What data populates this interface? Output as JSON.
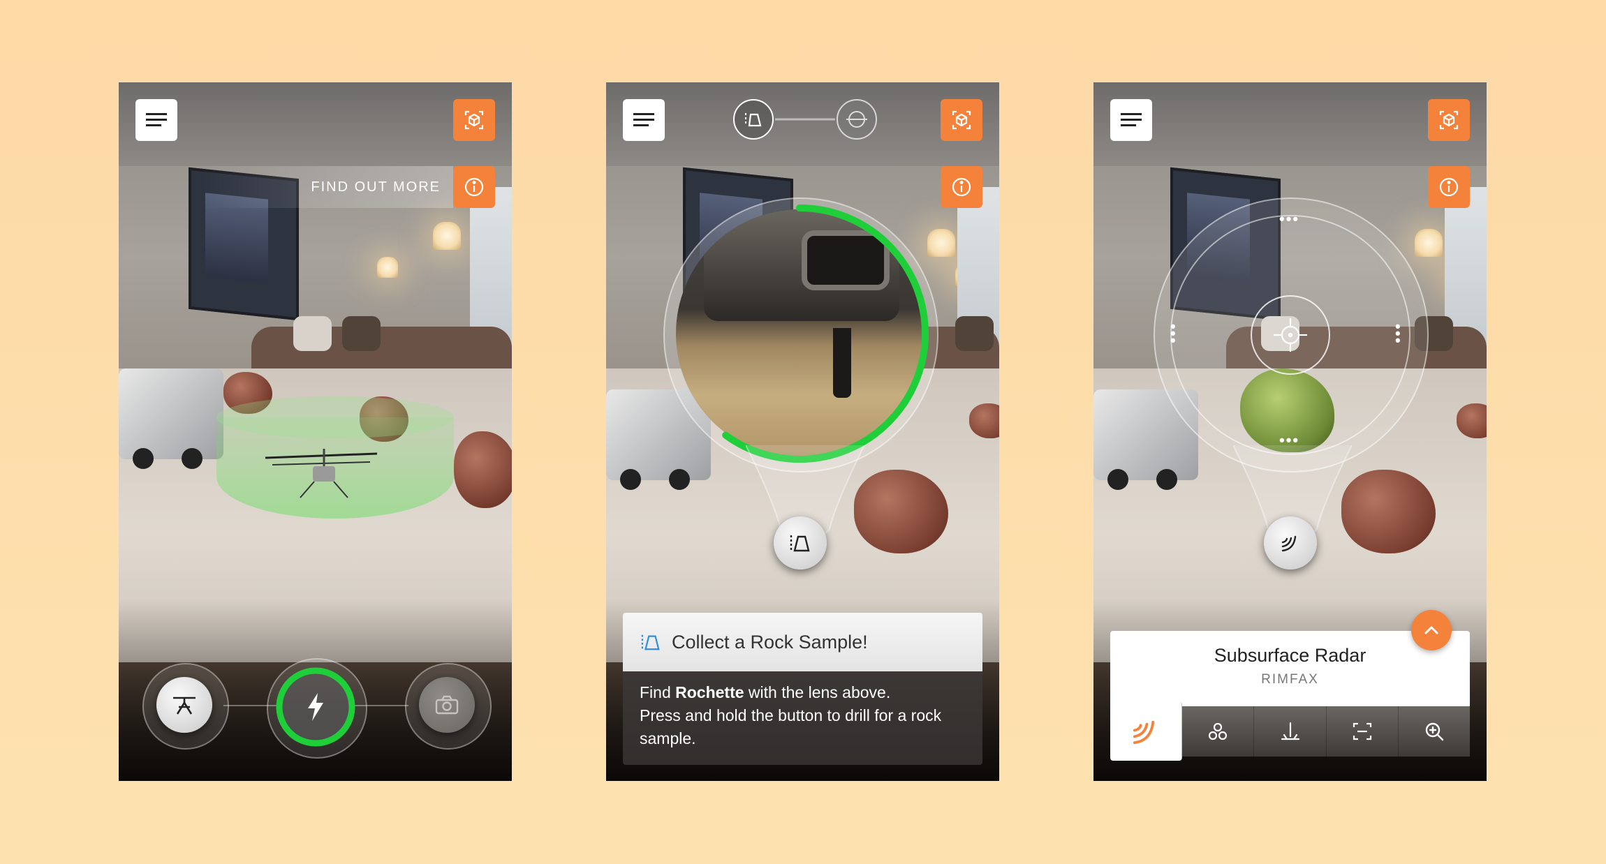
{
  "colors": {
    "accent": "#f5823a",
    "progress_green": "#1fcf3a",
    "background": "#fdd9a6"
  },
  "icons": {
    "menu": "hamburger-menu-icon",
    "cube": "ar-cube-icon",
    "info": "info-icon",
    "helicopter": "helicopter-icon",
    "bolt": "lightning-bolt-icon",
    "camera": "camera-icon",
    "drill": "drill-sample-icon",
    "target": "target-crosshair-icon",
    "radar": "radar-waves-icon"
  },
  "screen1": {
    "find_more": "FIND OUT MORE",
    "action_progress": 1.0
  },
  "screen2": {
    "drill_progress": 0.6,
    "card": {
      "title": "Collect a Rock Sample!",
      "line1_pre": "Find ",
      "line1_bold": "Rochette",
      "line1_post": " with the lens above.",
      "line2": "Press and hold the button to drill for a rock sample."
    }
  },
  "screen3": {
    "card": {
      "title": "Subsurface Radar",
      "subtitle": "RIMFAX"
    },
    "tabs": [
      {
        "name": "radar",
        "icon": "radar-waves-icon",
        "active": true
      },
      {
        "name": "molecules",
        "icon": "molecules-icon",
        "active": false
      },
      {
        "name": "drill",
        "icon": "drill-down-icon",
        "active": false
      },
      {
        "name": "scan",
        "icon": "scan-frame-icon",
        "active": false
      },
      {
        "name": "zoom",
        "icon": "zoom-in-icon",
        "active": false
      }
    ]
  }
}
